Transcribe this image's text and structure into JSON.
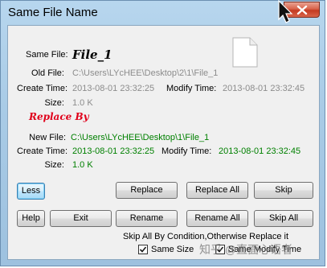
{
  "window": {
    "title": "Same File Name"
  },
  "old": {
    "same_file_label": "Same File:",
    "same_file_value": "File_1",
    "old_file_label": "Old File:",
    "old_file_path": "C:\\Users\\LYcHEE\\Desktop\\2\\1\\File_1",
    "create_label": "Create Time:",
    "create_value": "2013-08-01 23:32:25",
    "modify_label": "Modify Time:",
    "modify_value": "2013-08-01 23:32:45",
    "size_label": "Size:",
    "size_value": "1.0 K"
  },
  "replace_by": "Replace By",
  "new": {
    "new_file_label": "New File:",
    "new_file_path": "C:\\Users\\LYcHEE\\Desktop\\1\\File_1",
    "create_label": "Create Time:",
    "create_value": "2013-08-01 23:32:25",
    "modify_label": "Modify Time:",
    "modify_value": "2013-08-01 23:32:45",
    "size_label": "Size:",
    "size_value": "1.0 K"
  },
  "buttons": {
    "less": "Less",
    "replace": "Replace",
    "replace_all": "Replace All",
    "skip": "Skip",
    "help": "Help",
    "exit": "Exit",
    "rename": "Rename",
    "rename_all": "Rename All",
    "skip_all": "Skip All"
  },
  "condition": {
    "text": "Skip All By Condition,Otherwise Replace it",
    "same_size_label": "Same Size",
    "same_size_checked": true,
    "same_modify_label": "Same Modify Time",
    "same_modify_checked": true
  },
  "watermark": "知乎 @直面心语者",
  "colors": {
    "frame": "#a9cbe6",
    "green_text": "#008000",
    "red_heading": "#e0001a",
    "gray_text": "#8c8c8c"
  },
  "icons": [
    "close-icon",
    "file-icon",
    "checkmark-icon",
    "cursor-icon"
  ]
}
